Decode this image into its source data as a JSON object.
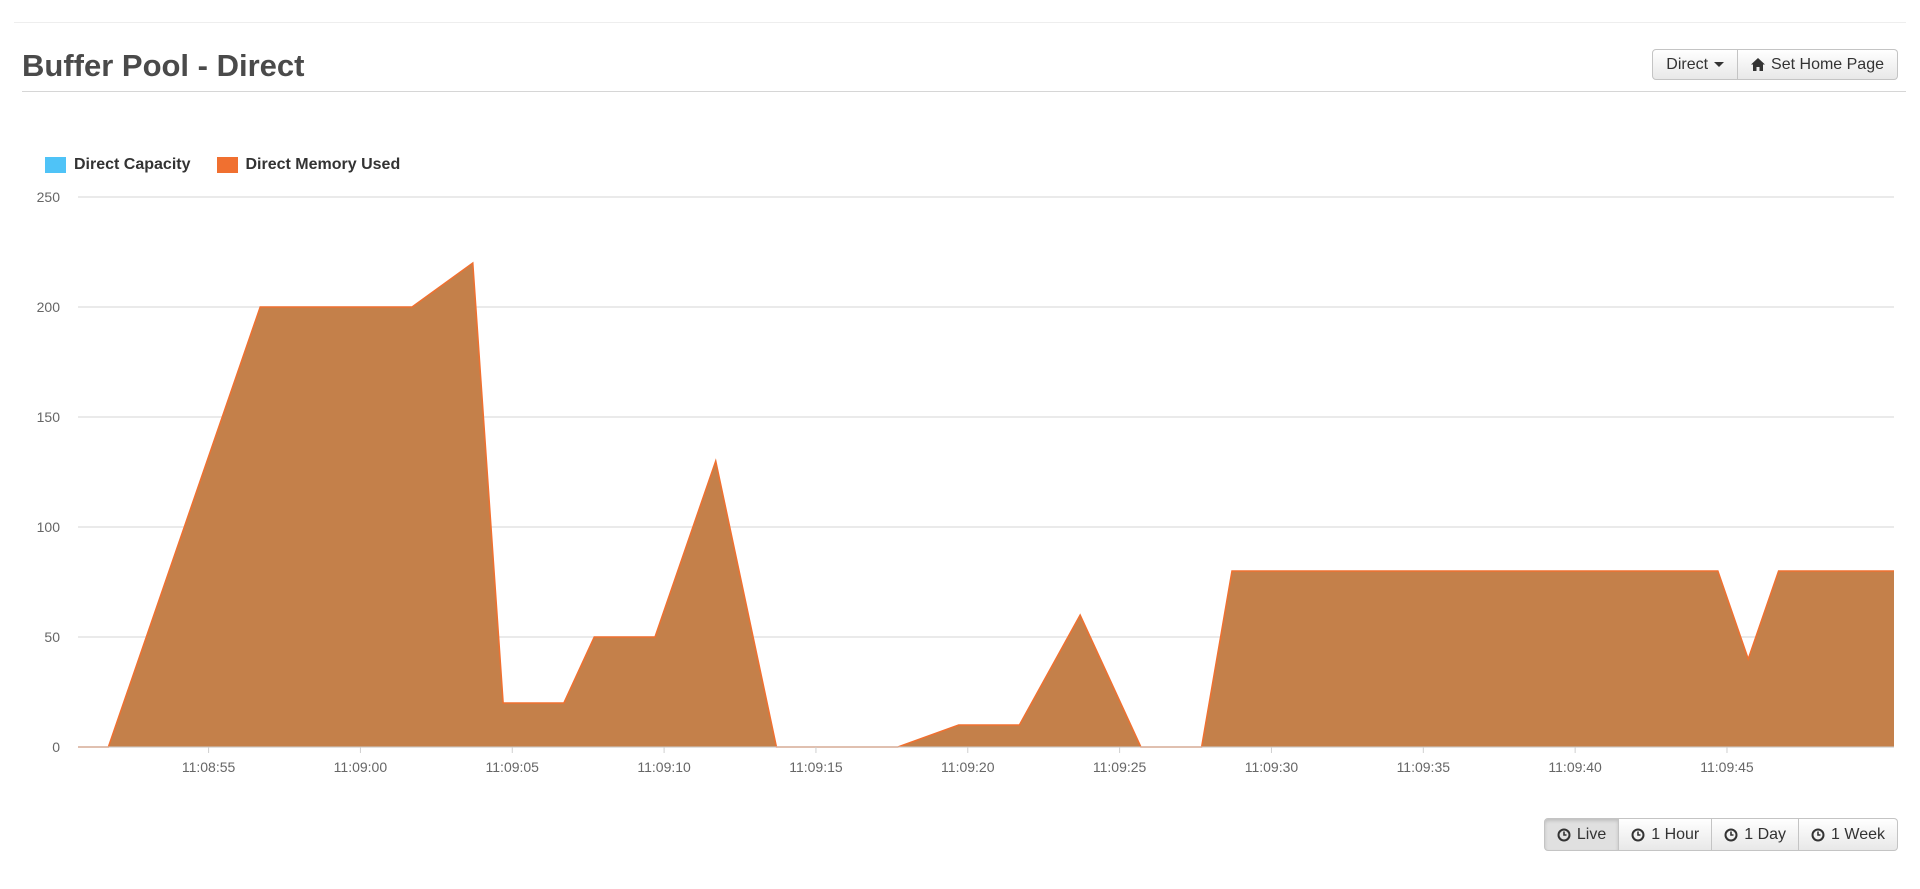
{
  "header": {
    "title": "Buffer Pool - Direct",
    "pool_select_label": "Direct",
    "set_home_label": "Set Home Page"
  },
  "time_range": {
    "buttons": [
      {
        "label": "Live",
        "active": true
      },
      {
        "label": "1 Hour",
        "active": false
      },
      {
        "label": "1 Day",
        "active": false
      },
      {
        "label": "1 Week",
        "active": false
      }
    ]
  },
  "icons": {
    "pool_select": "caret-down-icon",
    "set_home": "home-icon",
    "time_range": "clock-icon"
  },
  "colors": {
    "capacity": "#4fc3f7",
    "used_legend": "#f07030",
    "used_fill": "#c4804a",
    "used_line": "#f07030"
  },
  "chart_data": {
    "type": "area",
    "legend_position": "top-left",
    "grid": true,
    "ylim": [
      0,
      250
    ],
    "yticks": [
      0,
      50,
      100,
      150,
      200,
      250
    ],
    "xticks": [
      "11:08:55",
      "11:09:00",
      "11:09:05",
      "11:09:10",
      "11:09:15",
      "11:09:20",
      "11:09:25",
      "11:09:30",
      "11:09:35",
      "11:09:40",
      "11:09:45"
    ],
    "x_unit": "seconds after 11:08:50",
    "x_range": [
      0.7,
      60.5
    ],
    "series": [
      {
        "name": "Direct Capacity",
        "x": [],
        "values": []
      },
      {
        "name": "Direct Memory Used",
        "x": [
          0.7,
          1.7,
          6.7,
          11.7,
          13.7,
          14.7,
          15.7,
          16.7,
          17.7,
          19.7,
          21.7,
          23.7,
          25.7,
          26.7,
          27.7,
          29.7,
          31.7,
          33.7,
          35.7,
          37.7,
          38.7,
          39.7,
          40.7,
          42.7,
          44.7,
          49.7,
          54.7,
          55.7,
          56.7,
          58.7,
          60.5
        ],
        "values": [
          0,
          0,
          200,
          200,
          220,
          20,
          20,
          20,
          50,
          50,
          130,
          0,
          0,
          0,
          0,
          10,
          10,
          60,
          0,
          0,
          80,
          80,
          80,
          80,
          80,
          80,
          80,
          40,
          80,
          80,
          80
        ]
      }
    ]
  }
}
